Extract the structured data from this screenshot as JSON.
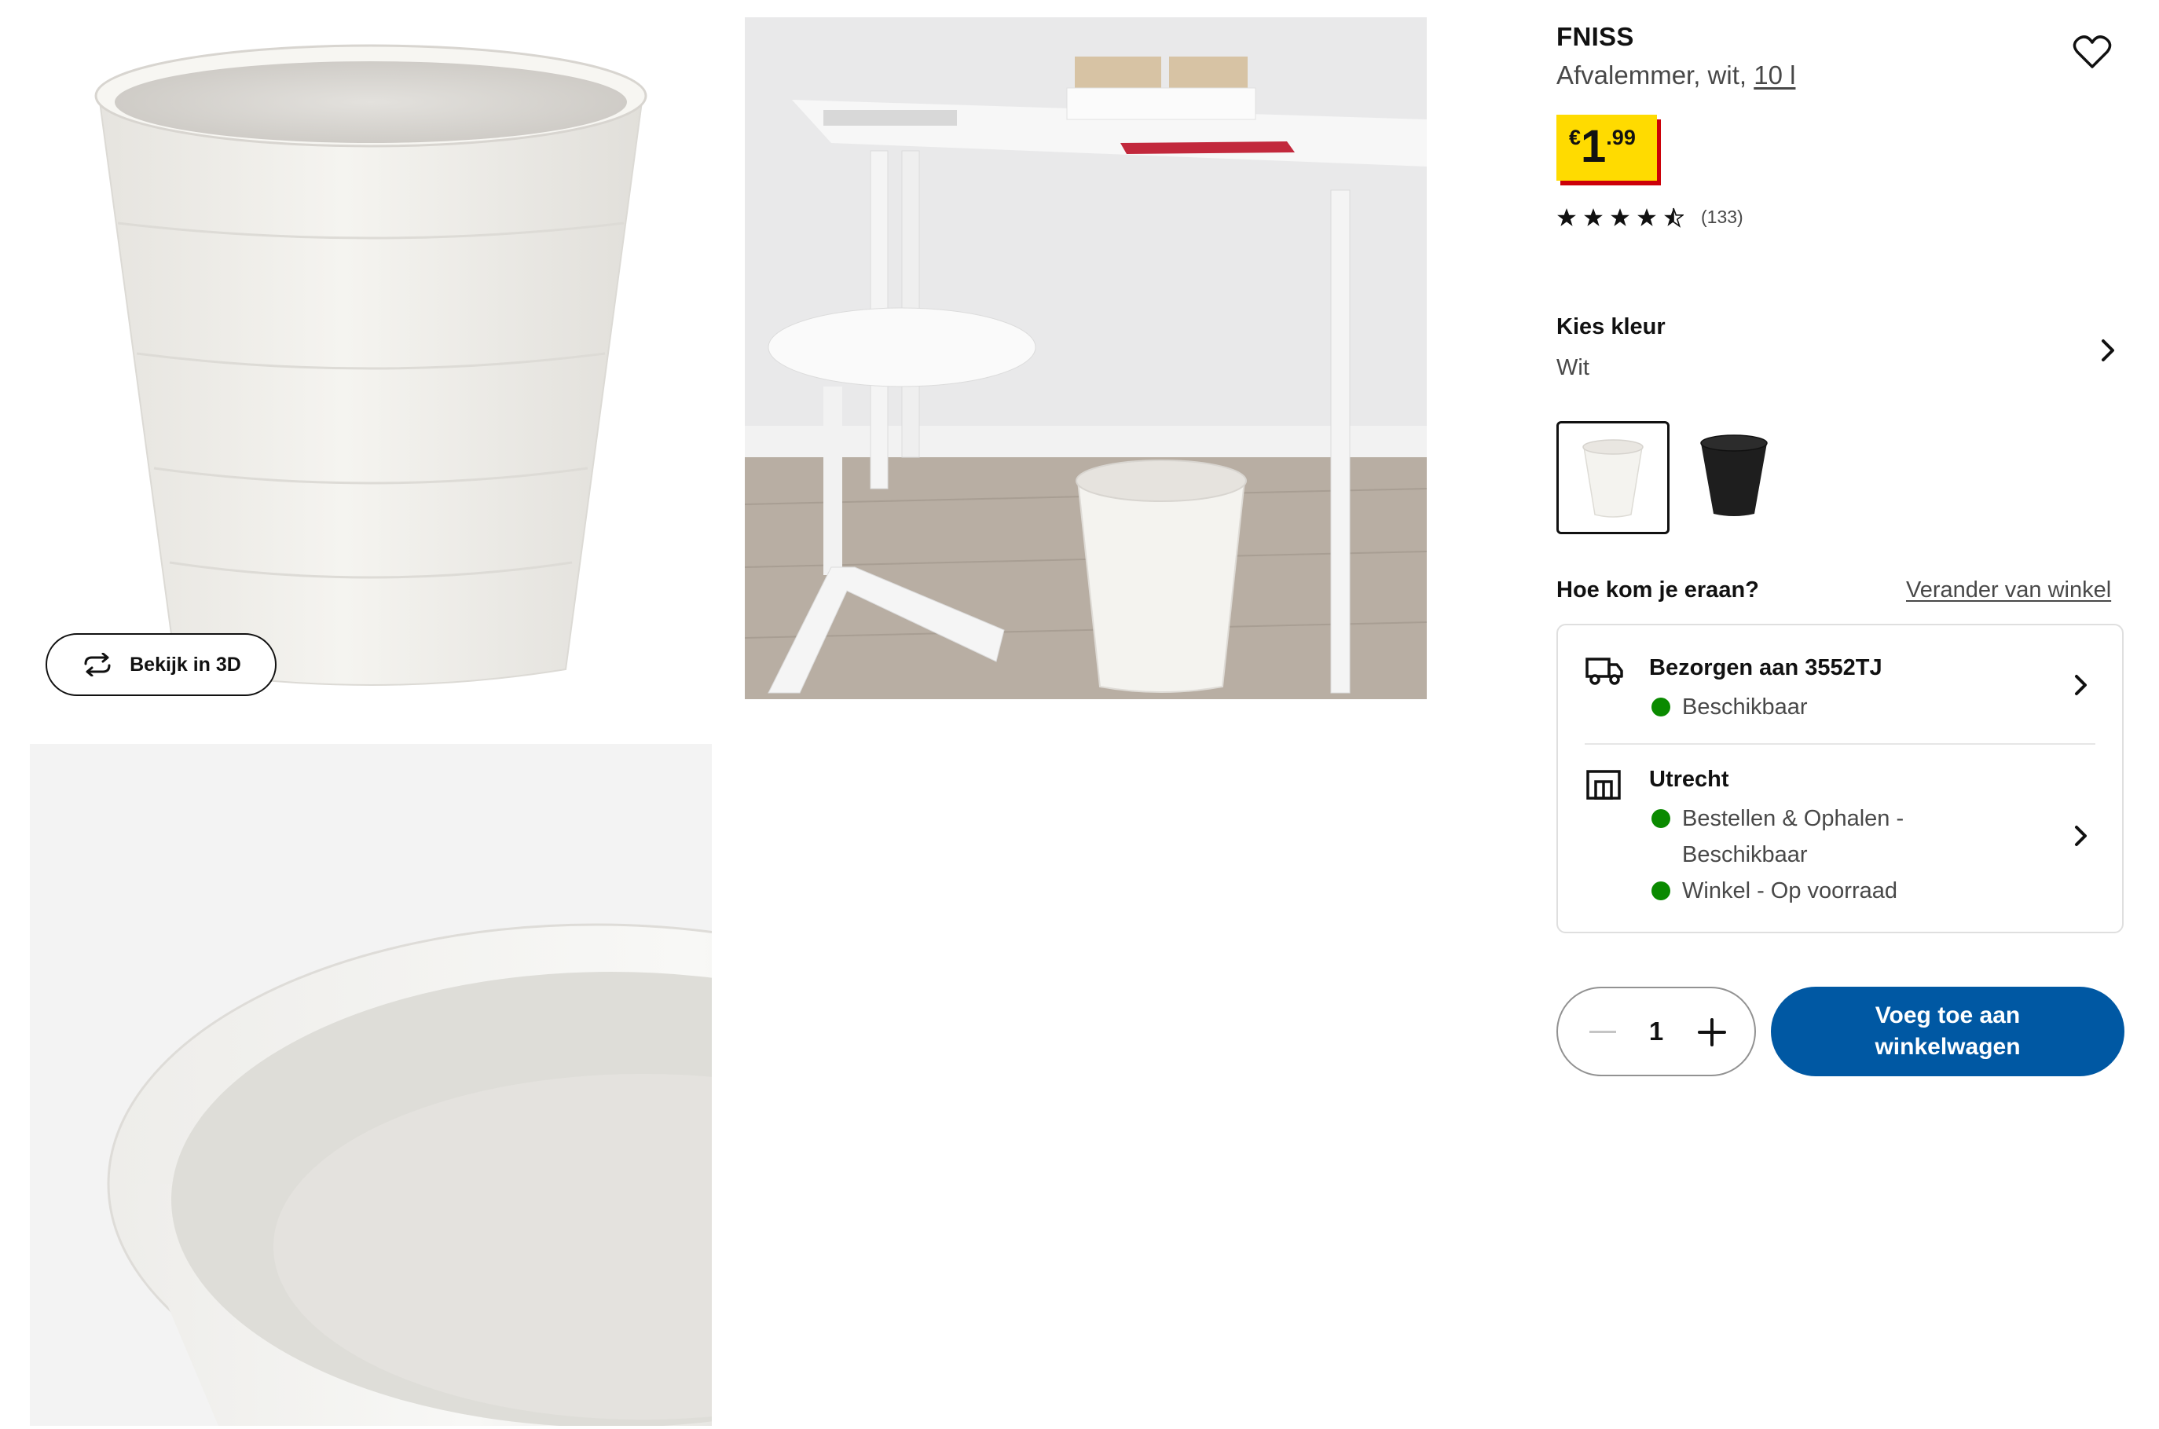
{
  "gallery": {
    "view_3d_label": "Bekijk in 3D"
  },
  "product": {
    "name": "FNISS",
    "subtitle_prefix": "Afvalemmer, wit, ",
    "size_link": "10 l",
    "price": {
      "currency": "€",
      "integer": "1",
      "decimal": ".99"
    },
    "rating": {
      "stars": 4.5,
      "max": 5,
      "count_label": "(133)"
    }
  },
  "color_picker": {
    "label": "Kies kleur",
    "selected": "Wit",
    "options": [
      {
        "name": "wit",
        "color": "#f4f3ef",
        "selected": true
      },
      {
        "name": "zwart",
        "color": "#1e1e1e",
        "selected": false
      }
    ]
  },
  "availability": {
    "heading": "Hoe kom je eraan?",
    "change_store_label": "Verander van winkel",
    "delivery": {
      "title": "Bezorgen aan 3552TJ",
      "status": "Beschikbaar"
    },
    "store": {
      "title": "Utrecht",
      "click_collect": "Bestellen & Ophalen -",
      "click_collect_status": "Beschikbaar",
      "in_store": "Winkel - Op voorraad"
    },
    "status_color": "#0a8a00"
  },
  "cart": {
    "quantity": "1",
    "add_label": "Voeg toe aan winkelwagen",
    "button_color": "#0058a3"
  },
  "colors": {
    "price_background": "#ffdb00",
    "price_shadow": "#cc0008"
  }
}
